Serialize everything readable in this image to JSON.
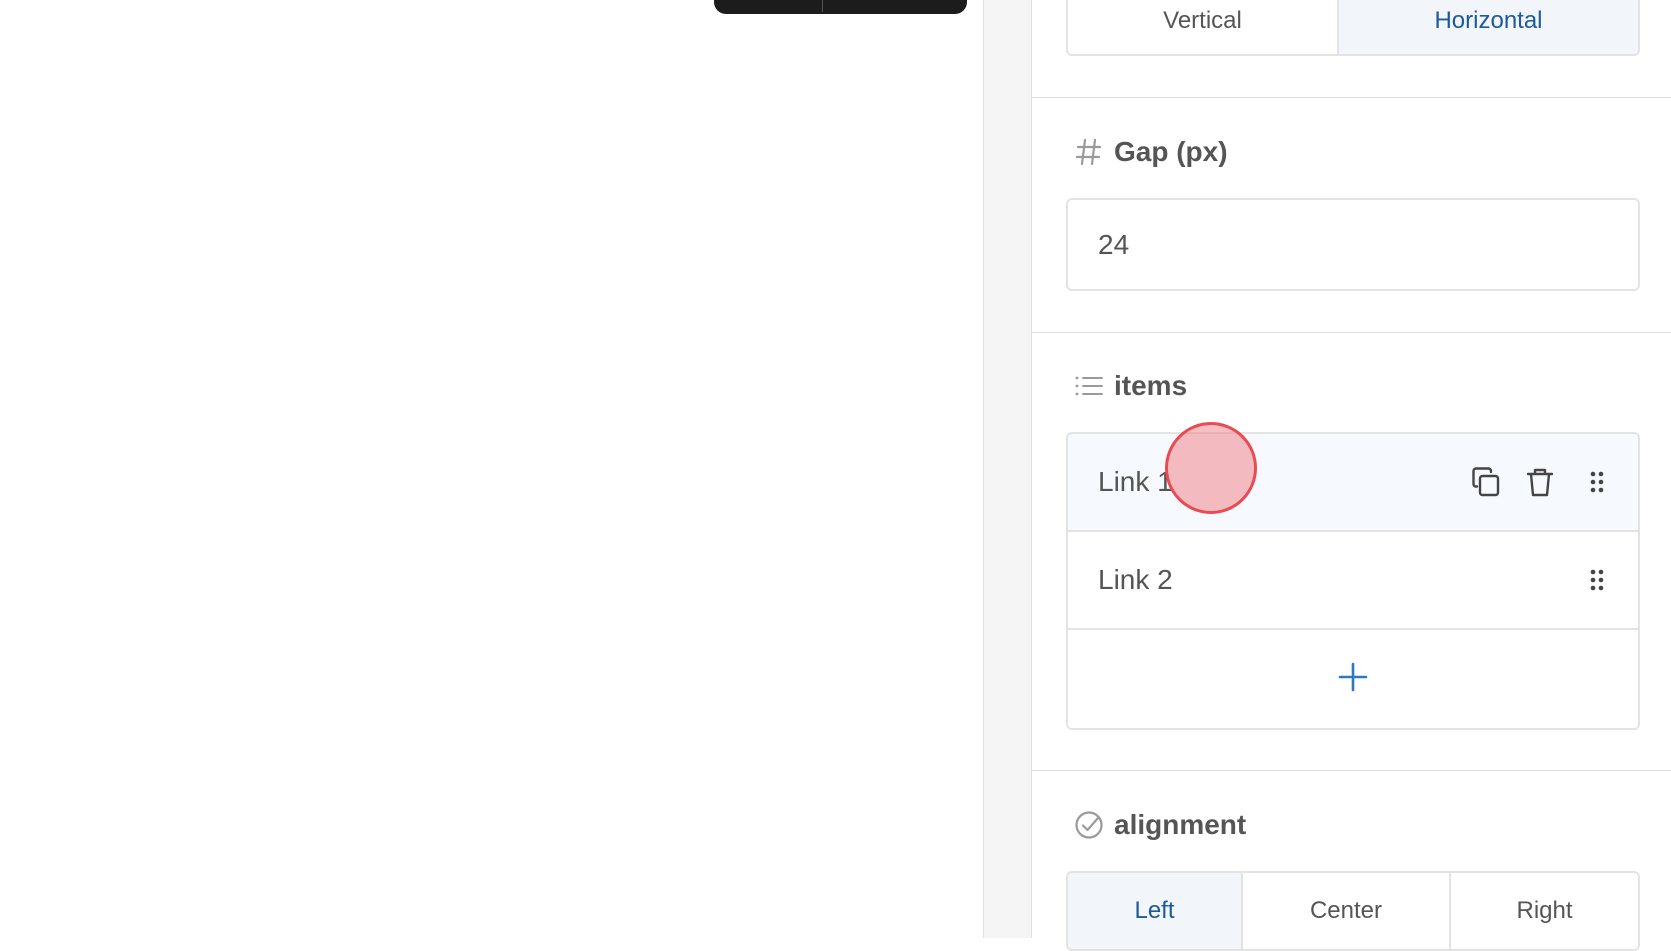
{
  "direction": {
    "options": [
      "Vertical",
      "Horizontal"
    ],
    "selected": "Horizontal"
  },
  "gap": {
    "label": "Gap (px)",
    "value": "24",
    "icon": "hash-icon"
  },
  "items": {
    "label": "items",
    "icon": "list-icon",
    "rows": [
      {
        "label": "Link 1",
        "actions": [
          "duplicate-icon",
          "trash-icon",
          "drag-handle-icon"
        ]
      },
      {
        "label": "Link 2",
        "actions": [
          "drag-handle-icon"
        ]
      }
    ],
    "add_icon": "plus-icon"
  },
  "alignment": {
    "label": "alignment",
    "icon": "radio-check-icon",
    "options": [
      "Left",
      "Center",
      "Right"
    ],
    "selected": "Left"
  },
  "colors": {
    "accent": "#1c5a9c",
    "add_accent": "#2f78c4",
    "click_marker": "#ea4a52"
  }
}
